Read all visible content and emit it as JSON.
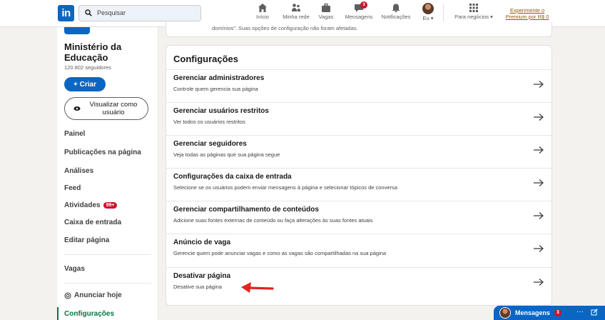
{
  "nav": {
    "logo": "in",
    "search_placeholder": "Pesquisar",
    "items": [
      {
        "label": "Início",
        "icon": "home-icon"
      },
      {
        "label": "Minha rede",
        "icon": "network-icon"
      },
      {
        "label": "Vagas",
        "icon": "briefcase-icon"
      },
      {
        "label": "Mensagens",
        "icon": "messaging-icon",
        "badge": "3"
      },
      {
        "label": "Notificações",
        "icon": "bell-icon"
      },
      {
        "label": "Eu ▾",
        "icon": "avatar"
      },
      {
        "label": "Para negócios ▾",
        "icon": "grid-icon"
      }
    ],
    "premium_line1": "Experimente o",
    "premium_line2": "Premium por R$ 0"
  },
  "sidebar": {
    "org_name": "Ministério da Educação",
    "followers": "120.802 seguidores",
    "create_label": "+ Criar",
    "view_as_label": "Visualizar como usuário",
    "items": [
      {
        "label": "Painel"
      },
      {
        "label": "Publicações na página"
      },
      {
        "label": "Análises"
      },
      {
        "label": "Feed"
      },
      {
        "label": "Atividades",
        "badge": "99+"
      },
      {
        "label": "Caixa de entrada"
      },
      {
        "label": "Editar página"
      },
      {
        "label": "Vagas"
      },
      {
        "label": "Anunciar hoje"
      },
      {
        "label": "Configurações"
      }
    ]
  },
  "top_card": {
    "text": "domínios”. Suas opções de configuração não foram afetadas."
  },
  "settings": {
    "title": "Configurações",
    "rows": [
      {
        "title": "Gerenciar administradores",
        "subtitle": "Controle quem gerencia sua página"
      },
      {
        "title": "Gerenciar usuários restritos",
        "subtitle": "Ver todos os usuários restritos"
      },
      {
        "title": "Gerenciar seguidores",
        "subtitle": "Veja todas as páginas que sua página segue"
      },
      {
        "title": "Configurações da caixa de entrada",
        "subtitle": "Selecione se os usuários podem enviar mensagens à página e selecionar tópicos de conversa"
      },
      {
        "title": "Gerenciar compartilhamento de conteúdos",
        "subtitle": "Adicione suas fontes externas de conteúdo ou faça alterações às suas fontes atuais"
      },
      {
        "title": "Anúncio de vaga",
        "subtitle": "Gerencie quem pode anunciar vagas e como as vagas são compartilhadas na sua página"
      },
      {
        "title": "Desativar página",
        "subtitle": "Desative sua página"
      }
    ]
  },
  "messaging": {
    "label": "Mensagens",
    "badge": "3",
    "more": "···"
  },
  "colors": {
    "brand": "#0a66c2",
    "alert": "#cb112d",
    "premium": "#915907",
    "active": "#057642"
  }
}
